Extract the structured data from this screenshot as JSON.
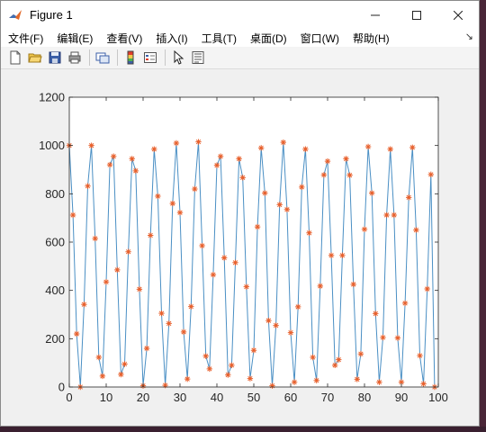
{
  "window": {
    "title": "Figure 1"
  },
  "menu": [
    {
      "label": "文件(F)",
      "key": "F"
    },
    {
      "label": "编辑(E)",
      "key": "E"
    },
    {
      "label": "查看(V)",
      "key": "V"
    },
    {
      "label": "插入(I)",
      "key": "I"
    },
    {
      "label": "工具(T)",
      "key": "T"
    },
    {
      "label": "桌面(D)",
      "key": "D"
    },
    {
      "label": "窗口(W)",
      "key": "W"
    },
    {
      "label": "帮助(H)",
      "key": "H"
    }
  ],
  "toolbar": [
    "new-figure-icon",
    "open-file-icon",
    "save-icon",
    "print-icon",
    "link-plot-icon",
    "insert-colorbar-icon",
    "insert-legend-icon",
    "pointer-icon",
    "property-inspector-icon"
  ],
  "colors": {
    "line": "#4a8fc4",
    "marker": "#e8602c",
    "axes": "#262626",
    "plot_bg": "#ffffff"
  },
  "chart_data": {
    "type": "line",
    "title": "",
    "xlabel": "",
    "ylabel": "",
    "xlim": [
      0,
      100
    ],
    "ylim": [
      0,
      1200
    ],
    "xticks": [
      0,
      10,
      20,
      30,
      40,
      50,
      60,
      70,
      80,
      90,
      100
    ],
    "yticks": [
      0,
      200,
      400,
      600,
      800,
      1000,
      1200
    ],
    "grid": false,
    "legend": "none",
    "marker": "*",
    "x": [
      0,
      1,
      2,
      3,
      4,
      5,
      6,
      7,
      8,
      9,
      10,
      11,
      12,
      13,
      14,
      15,
      16,
      17,
      18,
      19,
      20,
      21,
      22,
      23,
      24,
      25,
      26,
      27,
      28,
      29,
      30,
      31,
      32,
      33,
      34,
      35,
      36,
      37,
      38,
      39,
      40,
      41,
      42,
      43,
      44,
      45,
      46,
      47,
      48,
      49,
      50,
      51,
      52,
      53,
      54,
      55,
      56,
      57,
      58,
      59,
      60,
      61,
      62,
      63,
      64,
      65,
      66,
      67,
      68,
      69,
      70,
      71,
      72,
      73,
      74,
      75,
      76,
      77,
      78,
      79,
      80,
      81,
      82,
      83,
      84,
      85,
      86,
      87,
      88,
      89,
      90,
      91,
      92,
      93,
      94,
      95,
      96,
      97,
      98,
      99,
      100
    ],
    "y": [
      1000,
      712,
      220,
      0,
      342,
      832,
      1000,
      615,
      123,
      45,
      435,
      920,
      955,
      485,
      52,
      95,
      560,
      945,
      895,
      405,
      5,
      160,
      628,
      985,
      790,
      305,
      7,
      263,
      760,
      1010,
      722,
      228,
      33,
      333,
      820,
      1015,
      585,
      128,
      75,
      465,
      918,
      955,
      535,
      50,
      90,
      515,
      945,
      867,
      415,
      35,
      152,
      663,
      990,
      803,
      275,
      5,
      255,
      755,
      1013,
      735,
      225,
      20,
      332,
      828,
      985,
      638,
      123,
      27,
      418,
      878,
      935,
      545,
      90,
      113,
      545,
      945,
      877,
      425,
      32,
      137,
      653,
      995,
      803,
      304,
      20,
      205,
      712,
      985,
      712,
      203,
      20,
      347,
      785,
      992,
      650,
      130,
      13,
      406,
      880,
      0
    ]
  }
}
